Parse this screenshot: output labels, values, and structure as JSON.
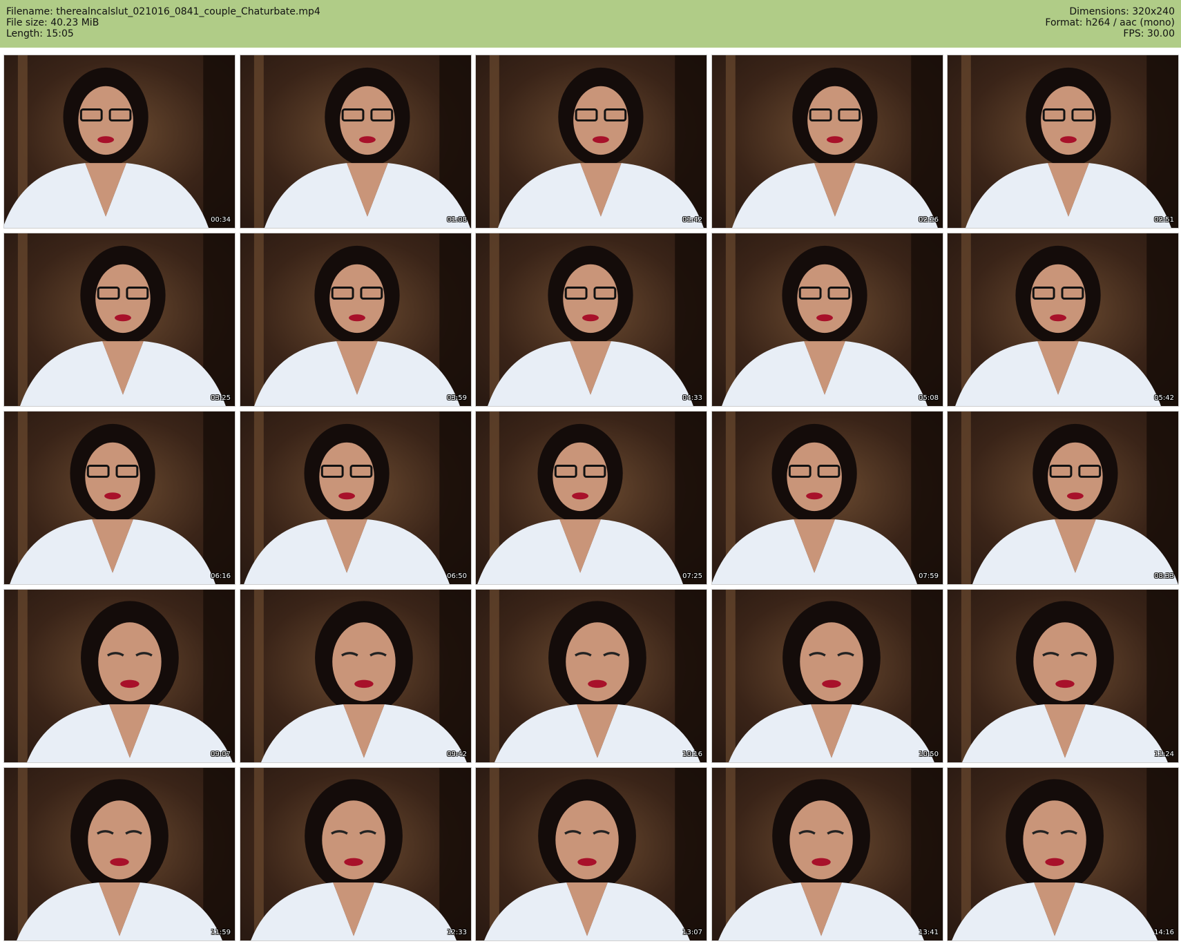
{
  "header": {
    "filename_line": "Filename: therealncalslut_021016_0841_couple_Chaturbate.mp4",
    "filesize_line": "File size: 40.23 MiB",
    "length_line": "Length: 15:05",
    "dimensions_line": "Dimensions: 320x240",
    "format_line": "Format: h264 / aac (mono)",
    "fps_line": "FPS: 30.00"
  },
  "thumbnails": [
    {
      "time": "00:34"
    },
    {
      "time": "01:08"
    },
    {
      "time": "01:42"
    },
    {
      "time": "02:16"
    },
    {
      "time": "02:51"
    },
    {
      "time": "03:25"
    },
    {
      "time": "03:59"
    },
    {
      "time": "04:33"
    },
    {
      "time": "05:08"
    },
    {
      "time": "05:42"
    },
    {
      "time": "06:16"
    },
    {
      "time": "06:50"
    },
    {
      "time": "07:25"
    },
    {
      "time": "07:59"
    },
    {
      "time": "08:33"
    },
    {
      "time": "09:07"
    },
    {
      "time": "09:42"
    },
    {
      "time": "10:16"
    },
    {
      "time": "10:50"
    },
    {
      "time": "11:24"
    },
    {
      "time": "11:59"
    },
    {
      "time": "12:33"
    },
    {
      "time": "13:07"
    },
    {
      "time": "13:41"
    },
    {
      "time": "14:16"
    }
  ],
  "colors": {
    "header_bg": "#b0cc87",
    "room_dark": "#2a1a12",
    "shirt": "#e8eef6",
    "hair": "#140c0a",
    "skin": "#c99579"
  }
}
